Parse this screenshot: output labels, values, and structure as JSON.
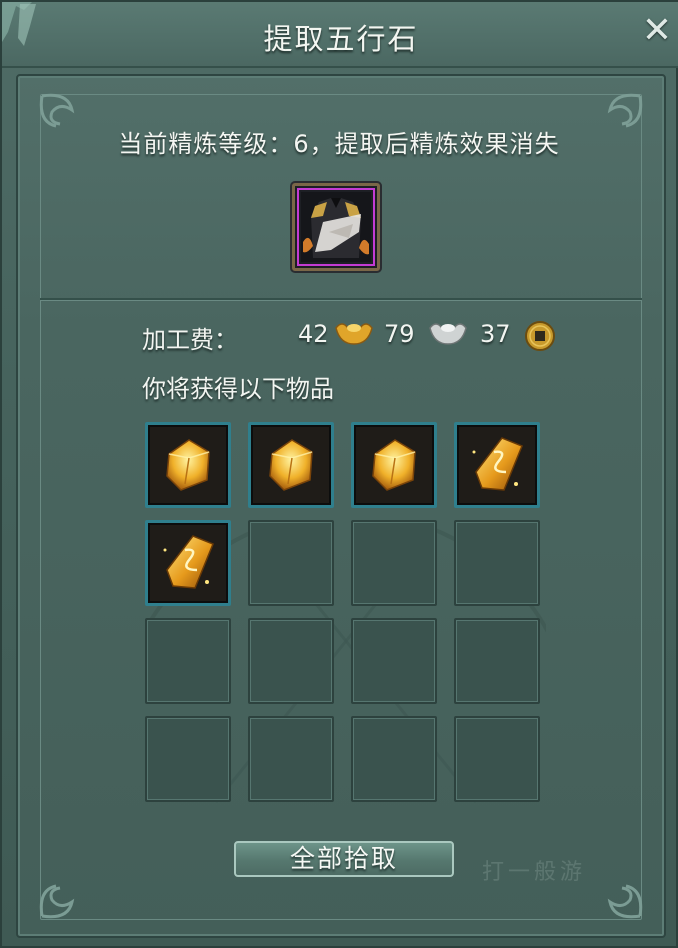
{
  "window": {
    "title": "提取五行石",
    "close_icon": "close-icon"
  },
  "status": {
    "text": "当前精炼等级：6，提取后精炼效果消失"
  },
  "equipment": {
    "icon": "robe-armor-icon",
    "rarity_color": "#c43bd3"
  },
  "fee": {
    "label": "加工费：",
    "gold": "42",
    "silver": "79",
    "copper": "37",
    "gold_icon": "gold-ingot-icon",
    "silver_icon": "silver-ingot-icon",
    "copper_icon": "copper-coin-icon"
  },
  "receive": {
    "label": "你将获得以下物品"
  },
  "items": [
    {
      "icon": "gold-stone-icon"
    },
    {
      "icon": "gold-stone-icon"
    },
    {
      "icon": "gold-stone-icon"
    },
    {
      "icon": "gold-shard-icon"
    },
    {
      "icon": "gold-shard-icon"
    }
  ],
  "grid": {
    "columns": 4,
    "rows": 4
  },
  "button": {
    "label": "全部拾取"
  },
  "watermark": "打一般游"
}
